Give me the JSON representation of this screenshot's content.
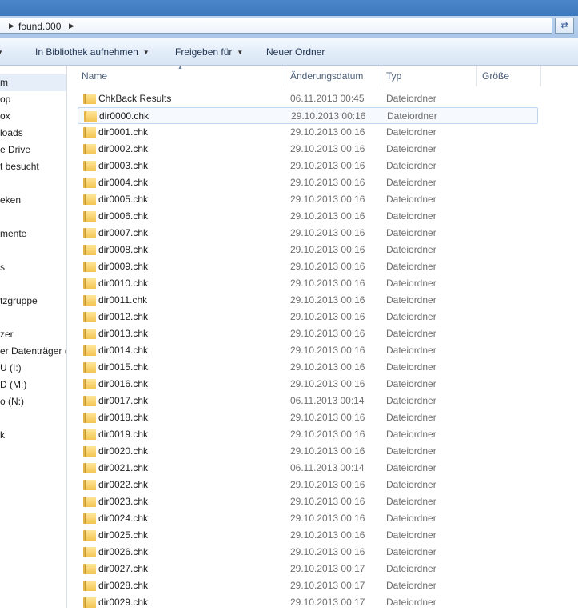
{
  "address": {
    "path": "found.000"
  },
  "toolbar": {
    "library": "In Bibliothek aufnehmen",
    "share": "Freigeben für",
    "new_folder": "Neuer Ordner"
  },
  "nav": {
    "items": [
      "m",
      "op",
      "ox",
      "loads",
      "e Drive",
      "t besucht",
      "eken",
      "mente",
      "s",
      "tzgruppe",
      "zer",
      "er Datenträger (C",
      "U (I:)",
      "D (M:)",
      "o (N:)",
      "k"
    ]
  },
  "columns": {
    "name": "Name",
    "date": "Änderungsdatum",
    "type": "Typ",
    "size": "Größe"
  },
  "files": [
    {
      "name": "ChkBack Results",
      "date": "06.11.2013 00:45",
      "type": "Dateiordner"
    },
    {
      "name": "dir0000.chk",
      "date": "29.10.2013 00:16",
      "type": "Dateiordner"
    },
    {
      "name": "dir0001.chk",
      "date": "29.10.2013 00:16",
      "type": "Dateiordner"
    },
    {
      "name": "dir0002.chk",
      "date": "29.10.2013 00:16",
      "type": "Dateiordner"
    },
    {
      "name": "dir0003.chk",
      "date": "29.10.2013 00:16",
      "type": "Dateiordner"
    },
    {
      "name": "dir0004.chk",
      "date": "29.10.2013 00:16",
      "type": "Dateiordner"
    },
    {
      "name": "dir0005.chk",
      "date": "29.10.2013 00:16",
      "type": "Dateiordner"
    },
    {
      "name": "dir0006.chk",
      "date": "29.10.2013 00:16",
      "type": "Dateiordner"
    },
    {
      "name": "dir0007.chk",
      "date": "29.10.2013 00:16",
      "type": "Dateiordner"
    },
    {
      "name": "dir0008.chk",
      "date": "29.10.2013 00:16",
      "type": "Dateiordner"
    },
    {
      "name": "dir0009.chk",
      "date": "29.10.2013 00:16",
      "type": "Dateiordner"
    },
    {
      "name": "dir0010.chk",
      "date": "29.10.2013 00:16",
      "type": "Dateiordner"
    },
    {
      "name": "dir0011.chk",
      "date": "29.10.2013 00:16",
      "type": "Dateiordner"
    },
    {
      "name": "dir0012.chk",
      "date": "29.10.2013 00:16",
      "type": "Dateiordner"
    },
    {
      "name": "dir0013.chk",
      "date": "29.10.2013 00:16",
      "type": "Dateiordner"
    },
    {
      "name": "dir0014.chk",
      "date": "29.10.2013 00:16",
      "type": "Dateiordner"
    },
    {
      "name": "dir0015.chk",
      "date": "29.10.2013 00:16",
      "type": "Dateiordner"
    },
    {
      "name": "dir0016.chk",
      "date": "29.10.2013 00:16",
      "type": "Dateiordner"
    },
    {
      "name": "dir0017.chk",
      "date": "06.11.2013 00:14",
      "type": "Dateiordner"
    },
    {
      "name": "dir0018.chk",
      "date": "29.10.2013 00:16",
      "type": "Dateiordner"
    },
    {
      "name": "dir0019.chk",
      "date": "29.10.2013 00:16",
      "type": "Dateiordner"
    },
    {
      "name": "dir0020.chk",
      "date": "29.10.2013 00:16",
      "type": "Dateiordner"
    },
    {
      "name": "dir0021.chk",
      "date": "06.11.2013 00:14",
      "type": "Dateiordner"
    },
    {
      "name": "dir0022.chk",
      "date": "29.10.2013 00:16",
      "type": "Dateiordner"
    },
    {
      "name": "dir0023.chk",
      "date": "29.10.2013 00:16",
      "type": "Dateiordner"
    },
    {
      "name": "dir0024.chk",
      "date": "29.10.2013 00:16",
      "type": "Dateiordner"
    },
    {
      "name": "dir0025.chk",
      "date": "29.10.2013 00:16",
      "type": "Dateiordner"
    },
    {
      "name": "dir0026.chk",
      "date": "29.10.2013 00:16",
      "type": "Dateiordner"
    },
    {
      "name": "dir0027.chk",
      "date": "29.10.2013 00:17",
      "type": "Dateiordner"
    },
    {
      "name": "dir0028.chk",
      "date": "29.10.2013 00:17",
      "type": "Dateiordner"
    },
    {
      "name": "dir0029.chk",
      "date": "29.10.2013 00:17",
      "type": "Dateiordner"
    }
  ]
}
